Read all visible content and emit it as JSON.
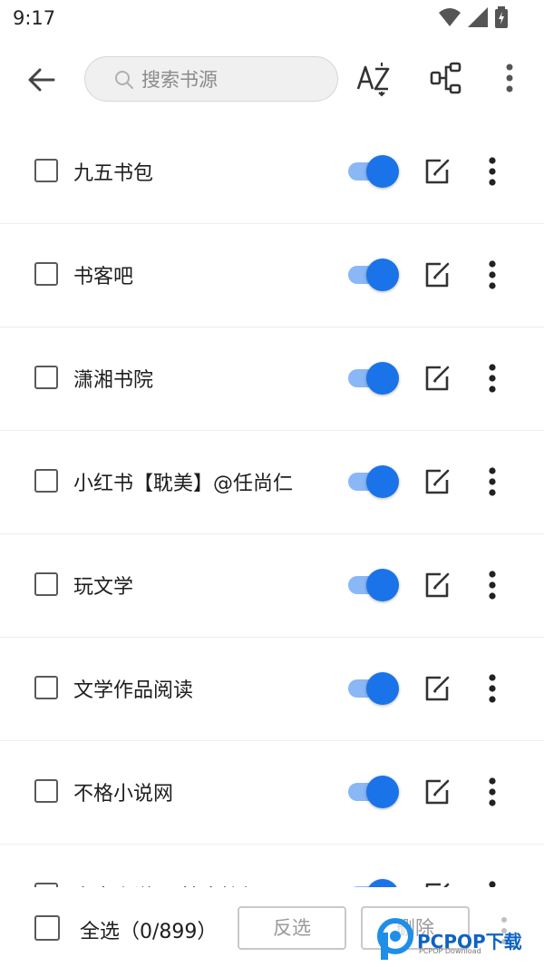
{
  "status_bar": {
    "time": "9:17"
  },
  "toolbar": {
    "search_placeholder": "搜索书源",
    "icons": [
      "arrow-left-icon",
      "sort-az-icon",
      "group-icon",
      "more-vert-icon"
    ]
  },
  "sources": [
    {
      "name": "九五书包",
      "enabled": true
    },
    {
      "name": "书客吧",
      "enabled": true
    },
    {
      "name": "潇湘书院",
      "enabled": true
    },
    {
      "name": "小红书【耽美】@任尚仁",
      "enabled": true
    },
    {
      "name": "玩文学",
      "enabled": true
    },
    {
      "name": "文学作品阅读",
      "enabled": true
    },
    {
      "name": "不格小说网",
      "enabled": true
    },
    {
      "name": "鬼去小说网[搜索接级]",
      "enabled": true
    }
  ],
  "bottom_bar": {
    "select_all_label": "全选（0/899）",
    "invert_label": "反选",
    "delete_label": "删除"
  },
  "watermark": {
    "text": "PCPOP下载",
    "sub": "PCPOP Download"
  },
  "colors": {
    "accent": "#1a73e8",
    "switch_track": "#8ab7f5"
  }
}
